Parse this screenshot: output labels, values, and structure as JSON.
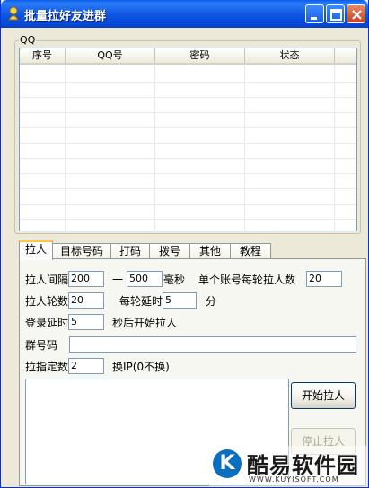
{
  "window": {
    "title": "批量拉好友进群",
    "buttons": {
      "minimize": "minimize-icon",
      "maximize": "maximize-icon",
      "close": "close-icon"
    }
  },
  "group": {
    "label": "QQ"
  },
  "table": {
    "columns": [
      "序号",
      "QQ号",
      "密码",
      "状态"
    ],
    "rows": []
  },
  "tabs": [
    "拉人",
    "目标号码",
    "打码",
    "拨号",
    "其他",
    "教程"
  ],
  "active_tab": "拉人",
  "form": {
    "interval_label": "拉人间隔",
    "interval_min": "200",
    "interval_dash": "一",
    "interval_max": "500",
    "interval_unit": "毫秒",
    "per_round_label": "单个账号每轮拉人数",
    "per_round_value": "20",
    "rounds_label": "拉人轮数",
    "rounds_value": "20",
    "round_delay_label": "每轮延时",
    "round_delay_value": "5",
    "round_delay_unit": "分",
    "login_delay_label": "登录延时",
    "login_delay_value": "5",
    "login_delay_suffix": "秒后开始拉人",
    "group_no_label": "群号码",
    "group_no_value": "",
    "specify_label": "拉指定数",
    "specify_value": "2",
    "change_ip_label": "换IP(0不换)"
  },
  "buttons": {
    "start": "开始拉人",
    "stop": "停止拉人"
  },
  "watermark": {
    "text": "酷易软件园",
    "url": "WWW.KUYISOFT.COM"
  }
}
